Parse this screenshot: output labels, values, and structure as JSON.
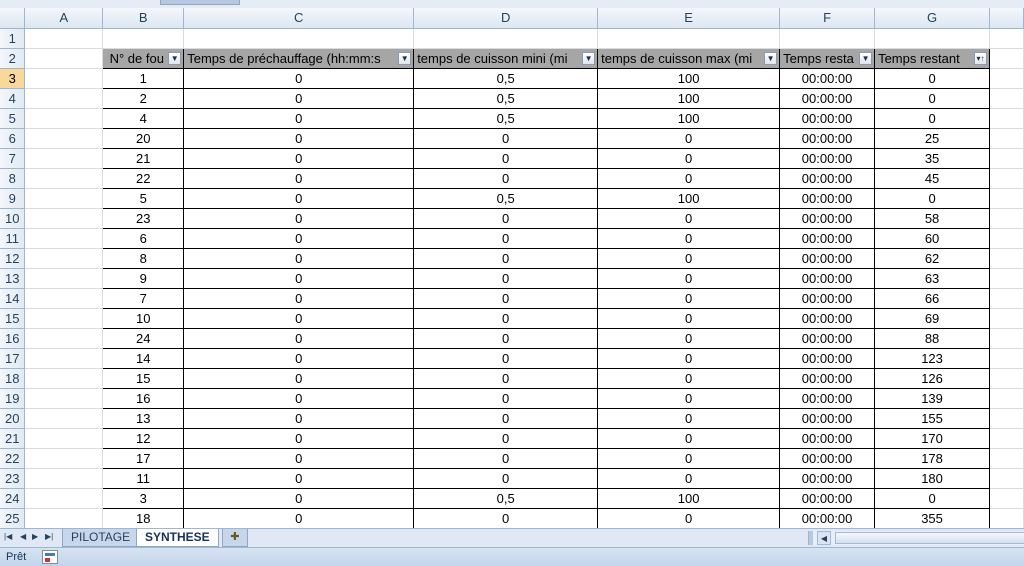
{
  "columns": [
    "A",
    "B",
    "C",
    "D",
    "E",
    "F",
    "G"
  ],
  "header_row": [
    "N° de fou",
    "Temps de préchauffage (hh:mm:s",
    "temps de cuisson mini (mi",
    "temps de cuisson max (mi",
    "Temps resta",
    "Temps restant"
  ],
  "rows": [
    {
      "num": "3",
      "b": "1",
      "c": "0",
      "d": "0,5",
      "e": "100",
      "f": "00:00:00",
      "g": "0"
    },
    {
      "num": "4",
      "b": "2",
      "c": "0",
      "d": "0,5",
      "e": "100",
      "f": "00:00:00",
      "g": "0"
    },
    {
      "num": "5",
      "b": "4",
      "c": "0",
      "d": "0,5",
      "e": "100",
      "f": "00:00:00",
      "g": "0"
    },
    {
      "num": "6",
      "b": "20",
      "c": "0",
      "d": "0",
      "e": "0",
      "f": "00:00:00",
      "g": "25"
    },
    {
      "num": "7",
      "b": "21",
      "c": "0",
      "d": "0",
      "e": "0",
      "f": "00:00:00",
      "g": "35"
    },
    {
      "num": "8",
      "b": "22",
      "c": "0",
      "d": "0",
      "e": "0",
      "f": "00:00:00",
      "g": "45"
    },
    {
      "num": "9",
      "b": "5",
      "c": "0",
      "d": "0,5",
      "e": "100",
      "f": "00:00:00",
      "g": "0"
    },
    {
      "num": "10",
      "b": "23",
      "c": "0",
      "d": "0",
      "e": "0",
      "f": "00:00:00",
      "g": "58"
    },
    {
      "num": "11",
      "b": "6",
      "c": "0",
      "d": "0",
      "e": "0",
      "f": "00:00:00",
      "g": "60"
    },
    {
      "num": "12",
      "b": "8",
      "c": "0",
      "d": "0",
      "e": "0",
      "f": "00:00:00",
      "g": "62"
    },
    {
      "num": "13",
      "b": "9",
      "c": "0",
      "d": "0",
      "e": "0",
      "f": "00:00:00",
      "g": "63"
    },
    {
      "num": "14",
      "b": "7",
      "c": "0",
      "d": "0",
      "e": "0",
      "f": "00:00:00",
      "g": "66"
    },
    {
      "num": "15",
      "b": "10",
      "c": "0",
      "d": "0",
      "e": "0",
      "f": "00:00:00",
      "g": "69"
    },
    {
      "num": "16",
      "b": "24",
      "c": "0",
      "d": "0",
      "e": "0",
      "f": "00:00:00",
      "g": "88"
    },
    {
      "num": "17",
      "b": "14",
      "c": "0",
      "d": "0",
      "e": "0",
      "f": "00:00:00",
      "g": "123"
    },
    {
      "num": "18",
      "b": "15",
      "c": "0",
      "d": "0",
      "e": "0",
      "f": "00:00:00",
      "g": "126"
    },
    {
      "num": "19",
      "b": "16",
      "c": "0",
      "d": "0",
      "e": "0",
      "f": "00:00:00",
      "g": "139"
    },
    {
      "num": "20",
      "b": "13",
      "c": "0",
      "d": "0",
      "e": "0",
      "f": "00:00:00",
      "g": "155"
    },
    {
      "num": "21",
      "b": "12",
      "c": "0",
      "d": "0",
      "e": "0",
      "f": "00:00:00",
      "g": "170"
    },
    {
      "num": "22",
      "b": "17",
      "c": "0",
      "d": "0",
      "e": "0",
      "f": "00:00:00",
      "g": "178"
    },
    {
      "num": "23",
      "b": "11",
      "c": "0",
      "d": "0",
      "e": "0",
      "f": "00:00:00",
      "g": "180"
    },
    {
      "num": "24",
      "b": "3",
      "c": "0",
      "d": "0,5",
      "e": "100",
      "f": "00:00:00",
      "g": "0"
    },
    {
      "num": "25",
      "b": "18",
      "c": "0",
      "d": "0",
      "e": "0",
      "f": "00:00:00",
      "g": "355"
    }
  ],
  "sheet_tabs": [
    "PILOTAGE",
    "SYNTHESE"
  ],
  "active_tab": "SYNTHESE",
  "status": "Prêt",
  "colors": {
    "header_fill": "#a6a6a6",
    "selected_row_header": "#f9d99b",
    "grid_line": "#dadcdd",
    "chrome": "#dfe8f4"
  }
}
